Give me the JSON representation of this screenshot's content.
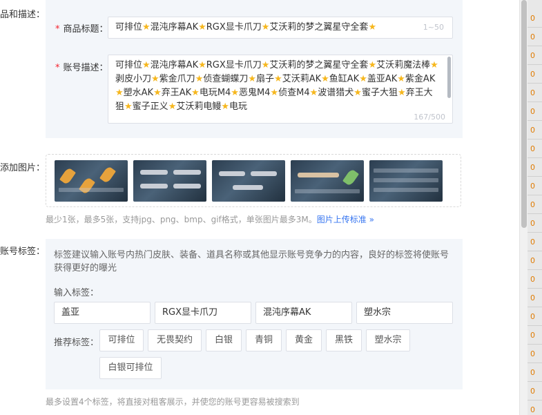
{
  "section_labels": {
    "title_desc": "品和描述：",
    "images": "添加图片：",
    "tags": "账号标签："
  },
  "title_field": {
    "required_mark": "*",
    "label": "商品标题：",
    "value": "可排位⭐混沌序幕AK⭐RGX显卡爪刀⭐艾沃莉的梦之翼星守全套⭐",
    "counter": "1~50"
  },
  "desc_field": {
    "required_mark": "*",
    "label": "账号描述：",
    "value": "可排位⭐混沌序幕AK⭐RGX显卡爪刀⭐艾沃莉的梦之翼星守全套⭐艾沃莉魔法棒⭐剥皮小刀⭐紫金爪刀⭐侦查蝴蝶刀⭐扇子⭐艾沃莉AK⭐鱼缸AK⭐盖亚AK⭐紫金AK⭐塑水AK⭐弃王AK⭐电玩M4⭐恶鬼M4⭐侦查M4⭐波谱猎犬⭐蜜子大狙⭐弃王大狙⭐蜜子正义⭐艾沃莉电鳗⭐电玩",
    "counter": "167/500"
  },
  "images": {
    "thumbnails": [
      "thumbnail-1",
      "thumbnail-2",
      "thumbnail-3",
      "thumbnail-4",
      "thumbnail-5"
    ],
    "hint": "最少1张，最多5张，支持jpg、png、bmp、gif格式，单张图片最多3M。",
    "link": "图片上传标准 »"
  },
  "tags": {
    "tip": "标签建议输入账号内热门皮肤、装备、道具名称或其他显示账号竞争力的内容，良好的标签将使账号获得更好的曝光",
    "input_label": "输入标签：",
    "inputs": [
      "盖亚",
      "RGX显卡爪刀",
      "混沌序幕AK",
      "塑水宗"
    ],
    "recommend_label": "推荐标签：",
    "recommended": [
      "可排位",
      "无畏契约",
      "白银",
      "青铜",
      "黄金",
      "黑铁",
      "塑水宗",
      "白银可排位"
    ],
    "footer_hint": "最多设置4个标签，将直接对租客展示，并使您的账号更容易被搜索到"
  },
  "edge_cells": [
    "0",
    "0",
    "0",
    "0",
    "0",
    "0",
    "0",
    "0",
    "0",
    "0",
    "0",
    "0",
    "0",
    "0",
    "0",
    "0",
    "0",
    "0",
    "0",
    "0",
    "0",
    "0"
  ]
}
